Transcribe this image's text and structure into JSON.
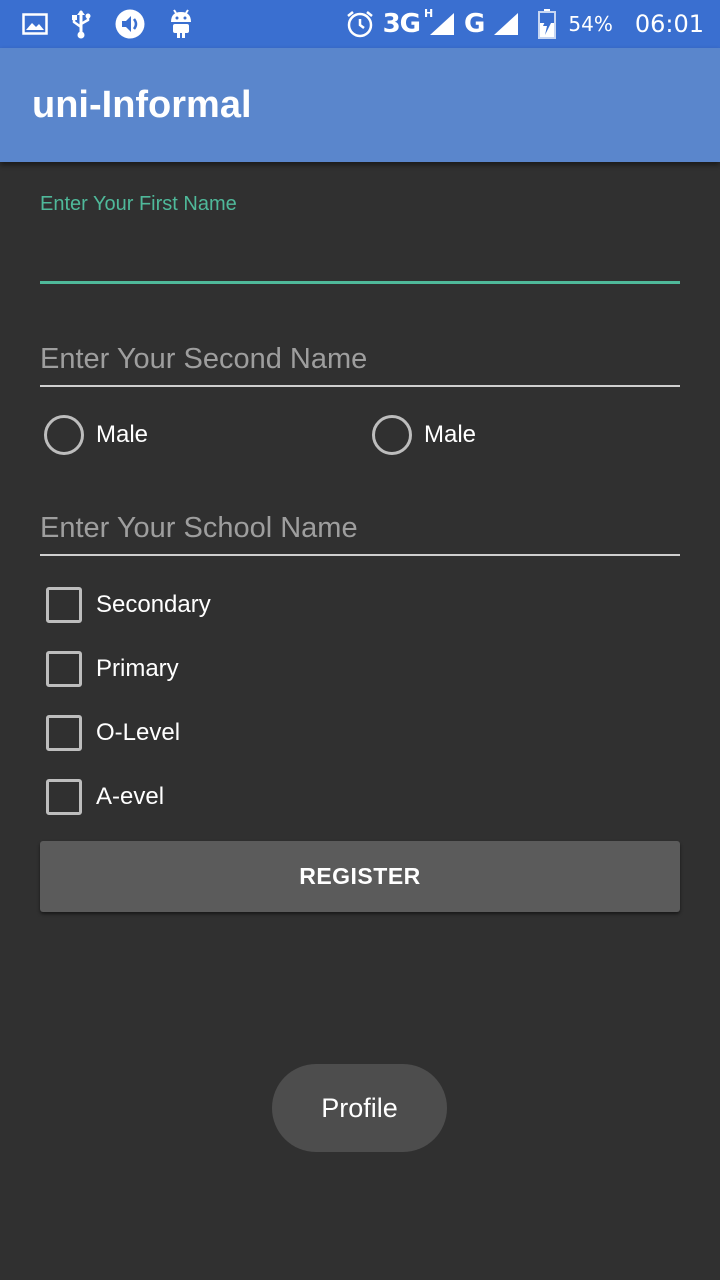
{
  "status_bar": {
    "icons_left": [
      "image-icon",
      "usb-icon",
      "volume-icon",
      "android-icon"
    ],
    "network_3g": "3G",
    "network_3g_sup": "H",
    "network_g": "G",
    "battery_percent": "54%",
    "time": "06:01"
  },
  "app_bar": {
    "title": "uni-Informal"
  },
  "form": {
    "first_name_label": "Enter Your First Name",
    "second_name_placeholder": "Enter Your Second Name",
    "gender_options": [
      "Male",
      "Male"
    ],
    "school_name_placeholder": "Enter Your School Name",
    "levels": [
      "Secondary",
      "Primary",
      "O-Level",
      "A-evel"
    ],
    "register_label": "REGISTER",
    "profile_label": "Profile"
  },
  "colors": {
    "status_bar": "#3a6fd0",
    "app_bar": "#5a86cc",
    "background": "#303030",
    "accent": "#4fb99a"
  }
}
